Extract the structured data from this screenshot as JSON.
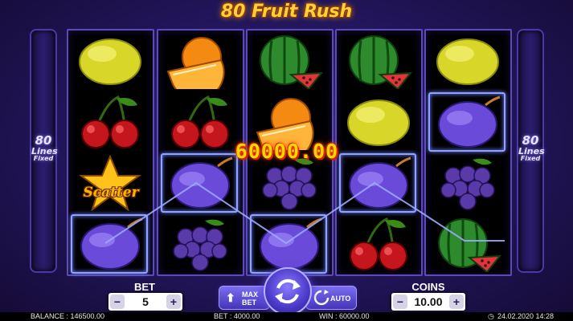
{
  "title": "80 Fruit Rush",
  "side_panels": {
    "lines_count": "80",
    "lines_word": "Lines",
    "fixed_word": "Fixed"
  },
  "reels": [
    [
      "lemon",
      "cherries",
      "scatter",
      "plum"
    ],
    [
      "orange",
      "cherries",
      "plum",
      "grapes"
    ],
    [
      "watermelon",
      "orange",
      "grapes",
      "plum"
    ],
    [
      "watermelon",
      "lemon",
      "plum",
      "cherries"
    ],
    [
      "lemon",
      "plum",
      "grapes",
      "watermelon"
    ]
  ],
  "scatter_label": "Scatter",
  "win_amount": "60000.00",
  "controls": {
    "bet_label": "BET",
    "bet_value": "5",
    "coins_label": "COINS",
    "coins_value": "10.00",
    "minus": "−",
    "plus": "+",
    "max_bet_line1": "MAX",
    "max_bet_line2": "BET",
    "auto_label": "AUTO"
  },
  "status_bar": {
    "balance": "BALANCE : 146500.00",
    "bet": "BET : 4000.00",
    "win": "WIN : 60000.00",
    "datetime": "24.02.2020 14:28"
  },
  "colors": {
    "title_gold": "#ffd23a",
    "win_yellow": "#ffd800",
    "reel_border": "#5b4bb5",
    "highlight_frame": "#8fa3ff"
  }
}
